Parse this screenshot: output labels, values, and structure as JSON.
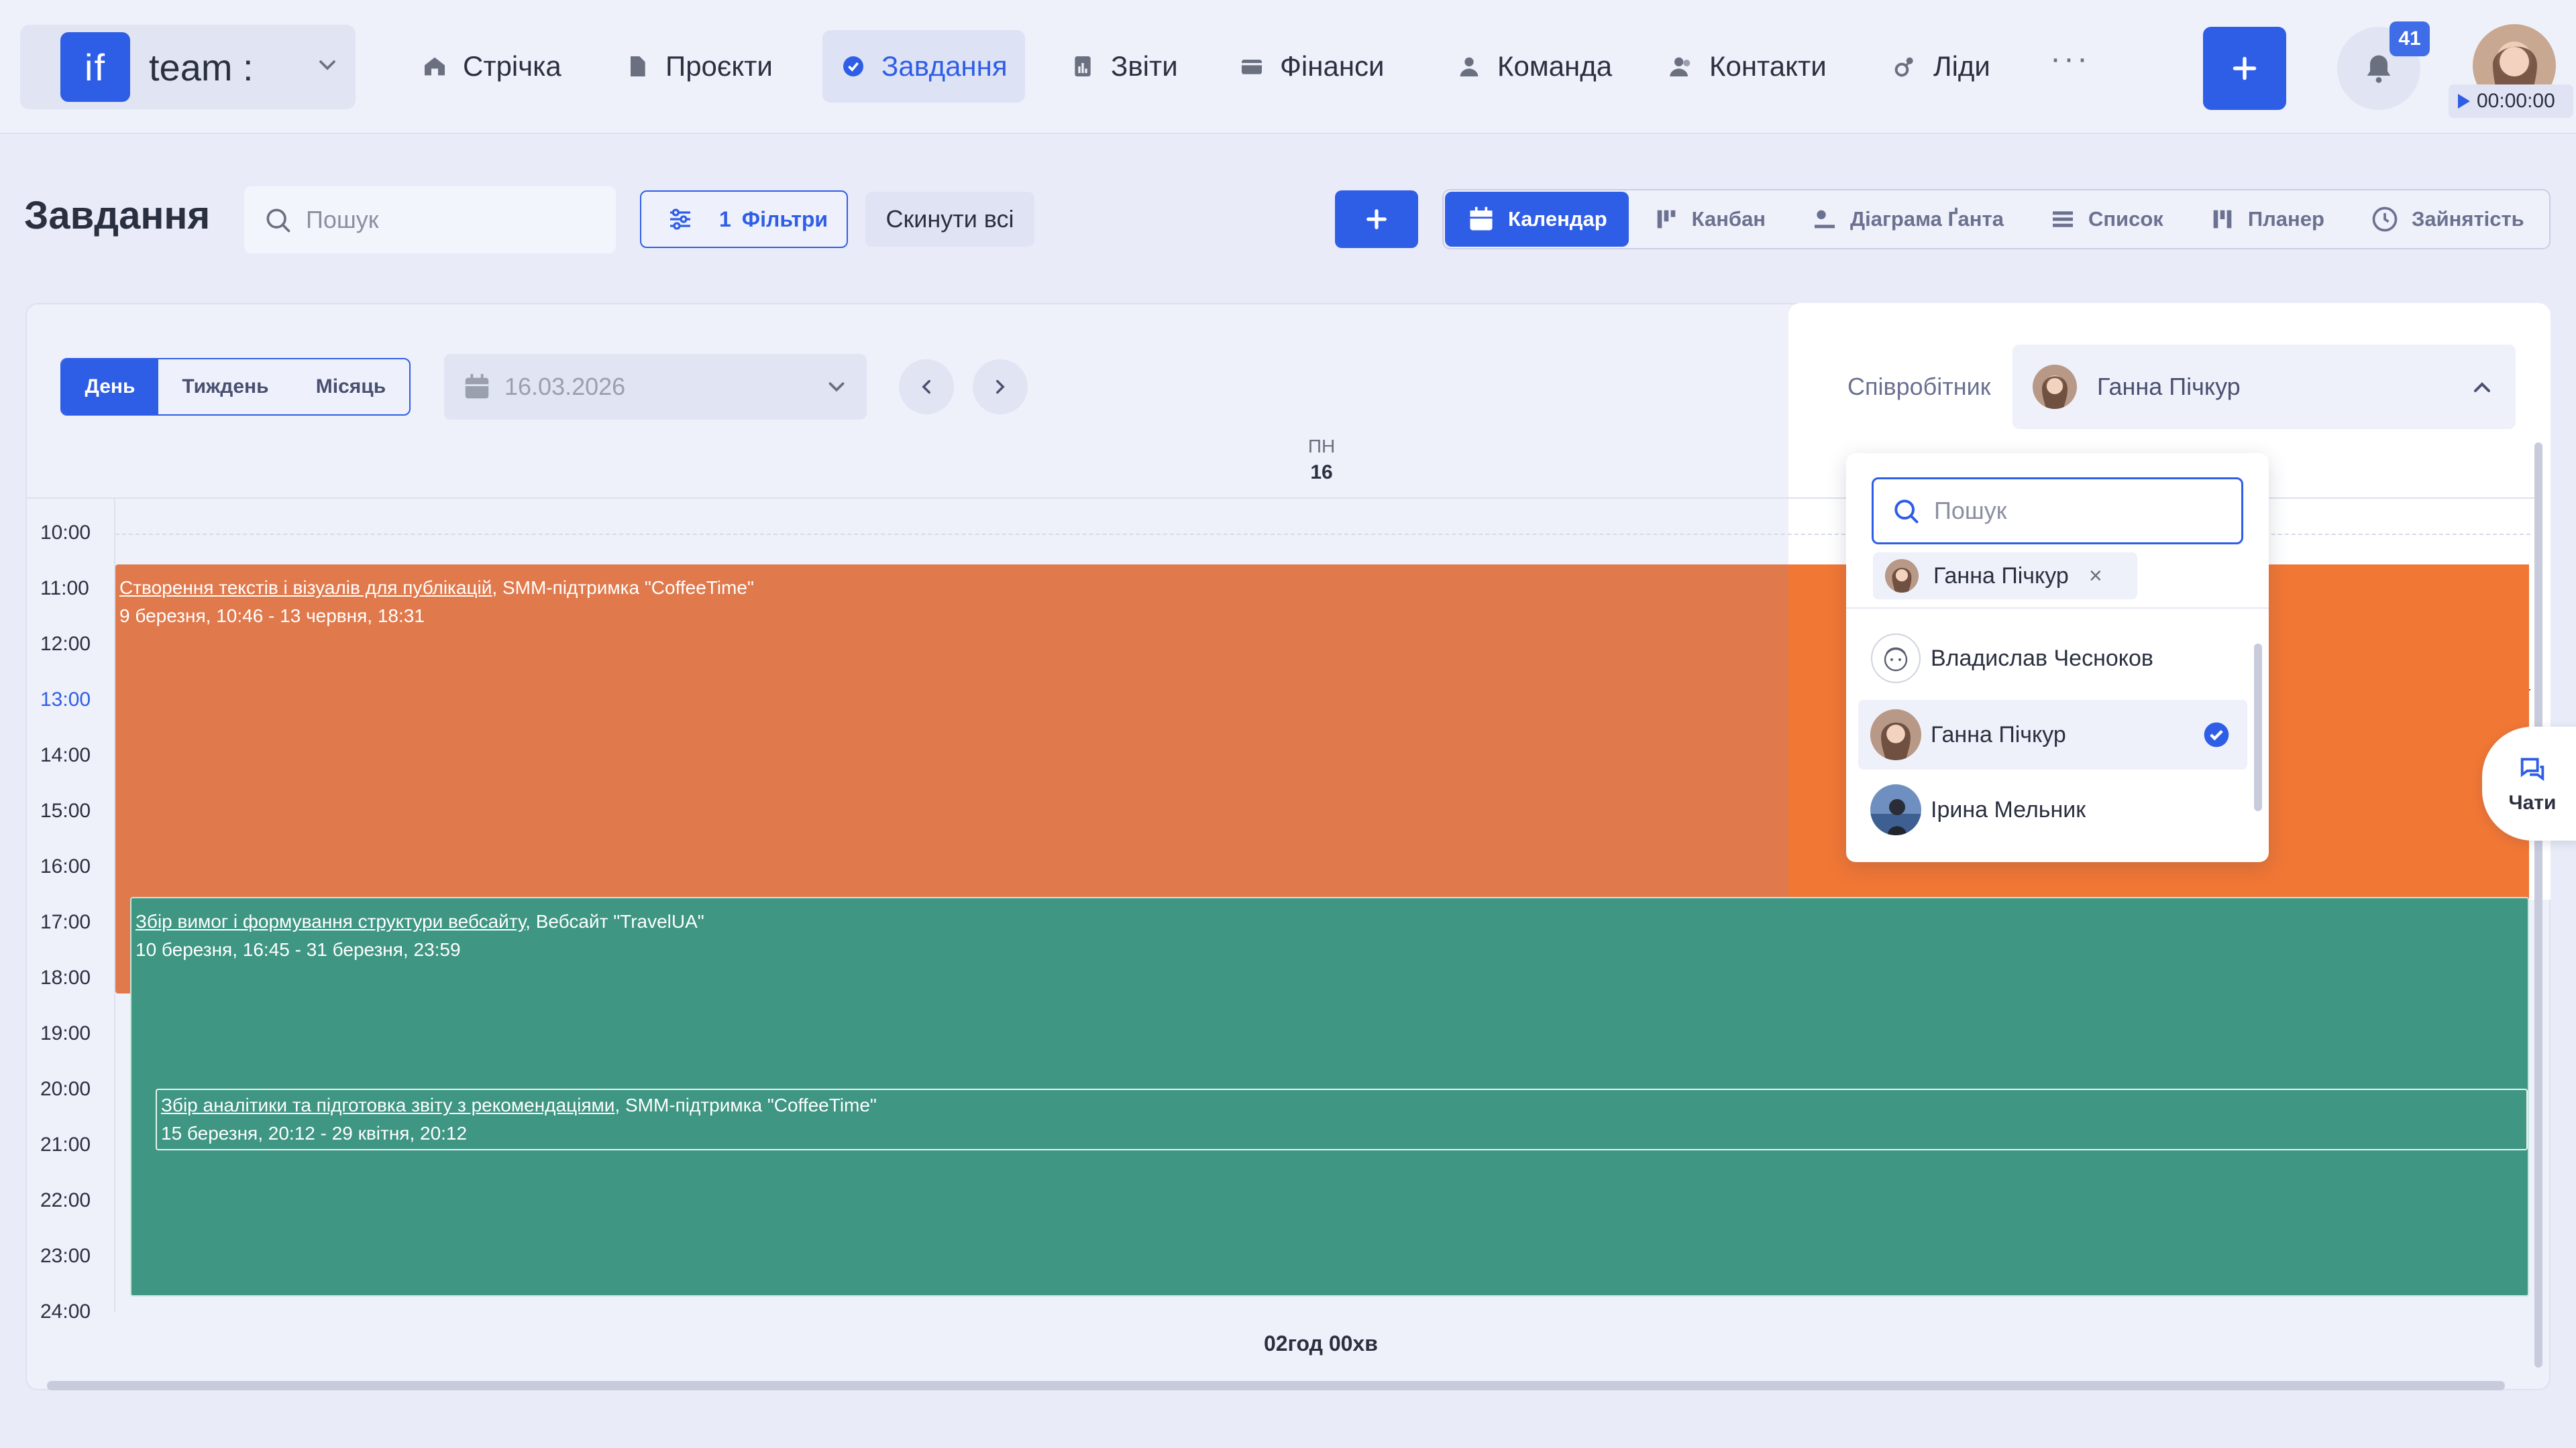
{
  "brand": {
    "logo": "if",
    "name": "team :"
  },
  "nav": [
    {
      "label": "Стрічка",
      "icon": "home-icon"
    },
    {
      "label": "Проєкти",
      "icon": "file-icon"
    },
    {
      "label": "Завдання",
      "icon": "check-circle-icon",
      "active": true
    },
    {
      "label": "Звіти",
      "icon": "report-icon"
    },
    {
      "label": "Фінанси",
      "icon": "wallet-icon"
    },
    {
      "label": "Команда",
      "icon": "user-icon"
    },
    {
      "label": "Контакти",
      "icon": "contacts-icon"
    },
    {
      "label": "Ліди",
      "icon": "leads-icon"
    }
  ],
  "nav_more": "···",
  "notifications_count": "41",
  "timer": "00:00:00",
  "page": {
    "title": "Завдання",
    "search_placeholder": "Пошук",
    "filters_count": "1",
    "filters_label": "Фільтри",
    "reset_label": "Скинути всі"
  },
  "view_tabs": [
    {
      "label": "Календар",
      "icon": "calendar-icon",
      "active": true
    },
    {
      "label": "Канбан",
      "icon": "kanban-icon"
    },
    {
      "label": "Діаграма Ґанта",
      "icon": "gantt-icon"
    },
    {
      "label": "Список",
      "icon": "list-icon"
    },
    {
      "label": "Планер",
      "icon": "planner-icon"
    },
    {
      "label": "Зайнятість",
      "icon": "clock-icon"
    }
  ],
  "calendar": {
    "ranges": [
      {
        "label": "День",
        "active": true
      },
      {
        "label": "Тиждень"
      },
      {
        "label": "Місяць"
      }
    ],
    "date": "16.03.2026",
    "day_name": "ПН",
    "day_number": "16",
    "hours": [
      "10:00",
      "11:00",
      "12:00",
      "13:00",
      "14:00",
      "15:00",
      "16:00",
      "17:00",
      "18:00",
      "19:00",
      "20:00",
      "21:00",
      "22:00",
      "23:00",
      "24:00"
    ],
    "current_hour": "13:00",
    "total": "02год 00хв",
    "events": [
      {
        "title": "Створення текстів і візуалів для публікацій",
        "project": ", SMM-підтримка \"CoffeeTime\"",
        "range": "9 березня, 10:46 - 13 червня, 18:31",
        "color": "#e0794c"
      },
      {
        "title": "Збір вимог і формування структури вебсайту",
        "project": ", Вебсайт \"TravelUA\"",
        "range": "10 березня, 16:45 - 31 березня, 23:59",
        "color": "#3e9683"
      },
      {
        "title": "Збір аналітики та підготовка звіту з рекомендаціями",
        "project": ", SMM-підтримка \"CoffeeTime\"",
        "range": "15 березня, 20:12 - 29 квітня, 20:12",
        "color": "#3e9683"
      }
    ]
  },
  "employee": {
    "label": "Співробітник",
    "selected": "Ганна Пічкур",
    "dropdown": {
      "search_placeholder": "Пошук",
      "chip": "Ганна Пічкур",
      "options": [
        {
          "name": "Владислав Чесноков"
        },
        {
          "name": "Ганна Пічкур",
          "selected": true
        },
        {
          "name": "Ірина Мельник"
        }
      ]
    }
  },
  "chat_label": "Чати",
  "colors": {
    "accent": "#2f5ee6",
    "event_orange": "#e0794c",
    "event_green": "#3e9683"
  }
}
